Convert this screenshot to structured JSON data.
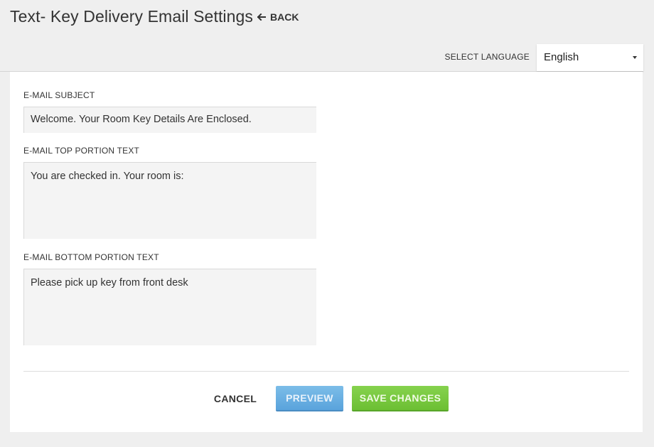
{
  "header": {
    "title": "Text- Key Delivery Email Settings",
    "back_label": "BACK"
  },
  "language": {
    "label": "SELECT LANGUAGE",
    "selected": "English"
  },
  "form": {
    "subject": {
      "label": "E-MAIL SUBJECT",
      "value": "Welcome. Your Room Key Details Are Enclosed."
    },
    "top_text": {
      "label": "E-MAIL TOP PORTION TEXT",
      "value": "You are checked in. Your room is:"
    },
    "bottom_text": {
      "label": "E-MAIL BOTTOM PORTION TEXT",
      "value": "Please pick up key from front desk"
    }
  },
  "actions": {
    "cancel_label": "CANCEL",
    "preview_label": "PREVIEW",
    "save_label": "SAVE CHANGES"
  },
  "colors": {
    "preview_button": "#5aa3dc",
    "save_button": "#6cbf33",
    "background": "#efefef"
  }
}
